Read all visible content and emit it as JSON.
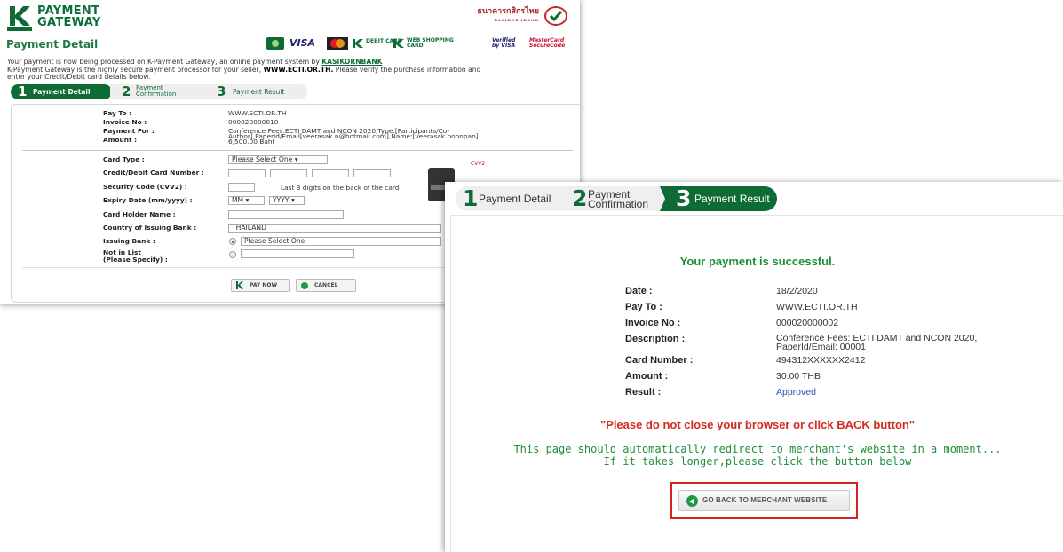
{
  "left": {
    "logo": {
      "line1": "PAYMENT",
      "line2": "GATEWAY",
      "mark_text": "KASIKORNBANK"
    },
    "bank": {
      "thai": "ธนาคารกสิกรไทย",
      "en": "KASIKORNBANK"
    },
    "section_title": "Payment Detail",
    "card_brands": [
      "VISA",
      "DEBIT CARD",
      "WEB SHOPPING CARD",
      "Verified by VISA",
      "MasterCard SecureCode"
    ],
    "intro": {
      "line1_prefix": "Your payment is now being processed on K-Payment Gateway, an online payment system by",
      "line1_link": "KASIKORNBANK",
      "line2_prefix": "K-Payment Gateway is the highly secure payment processor for your seller,",
      "line2_bold": "WWW.ECTI.OR.TH.",
      "line2_suffix": "Please verify the purchase information and",
      "line3": "enter your Credit/Debit card details below."
    },
    "steps": [
      {
        "num": "1",
        "label": "Payment Detail"
      },
      {
        "num": "2",
        "label": "Payment Confirmation"
      },
      {
        "num": "3",
        "label": "Payment Result"
      }
    ],
    "summary": {
      "pay_to_label": "Pay To :",
      "pay_to": "WWW.ECTI.OR.TH",
      "invoice_label": "Invoice No :",
      "invoice": "000020000010",
      "pay_for_label": "Payment For :",
      "pay_for_l1": "Conference Fees:ECTI DAMT and NCON 2020,Type:[Participants/Co-",
      "pay_for_l2": "Author],PaperId/Email[veerasak.n@hotmail.com],Name:[veerasak noonpan]",
      "amount_label": "Amount :",
      "amount": "6,500.00 Baht"
    },
    "form": {
      "card_type_label": "Card Type :",
      "card_type_value": "Please Select One",
      "card_number_label": "Credit/Debit Card Number :",
      "cvv_label": "Security Code (CVV2) :",
      "cvv_hint": "Last 3 digits on the back of the card",
      "cvv_pic_label": "CVV2",
      "expiry_label": "Expiry Date (mm/yyyy) :",
      "expiry_mm": "MM",
      "expiry_yyyy": "YYYY",
      "holder_label": "Card Holder Name :",
      "country_label": "Country of Issuing Bank :",
      "country_value": "THAILAND",
      "issuing_label": "Issuing Bank :",
      "issuing_value": "Please Select One",
      "notlist_label_l1": "Not in List",
      "notlist_label_l2": "(Please Specify) :"
    },
    "buttons": {
      "pay_now": "PAY NOW",
      "cancel": "CANCEL"
    }
  },
  "right": {
    "steps": [
      {
        "num": "1",
        "label": "Payment Detail"
      },
      {
        "num": "2",
        "label_l1": "Payment",
        "label_l2": "Confirmation"
      },
      {
        "num": "3",
        "label": "Payment Result"
      }
    ],
    "headline": "Your payment is successful.",
    "rows": [
      {
        "label": "Date :",
        "value": "18/2/2020"
      },
      {
        "label": "Pay To :",
        "value": "WWW.ECTI.OR.TH"
      },
      {
        "label": "Invoice No :",
        "value": "000020000002"
      },
      {
        "label": "Description :",
        "value_l1": "Conference Fees: ECTI DAMT and NCON 2020,",
        "value_l2": "PaperId/Email: 00001"
      },
      {
        "label": "Card Number :",
        "value": "494312XXXXXX2412"
      },
      {
        "label": "Amount :",
        "value": "30.00 THB"
      },
      {
        "label": "Result :",
        "value": "Approved"
      }
    ],
    "warning": "\"Please do not close your browser or click BACK button\"",
    "redirect_l1": "This page should automatically redirect to merchant's website in a moment...",
    "redirect_l2": "If it takes longer,please click the button below",
    "back_button": "GO BACK TO MERCHANT WEBSITE"
  },
  "colors": {
    "brand_green": "#0e6b36",
    "success_green": "#1f8f3a",
    "warning_red": "#d12a1e",
    "approved_blue": "#2b4fb3"
  }
}
